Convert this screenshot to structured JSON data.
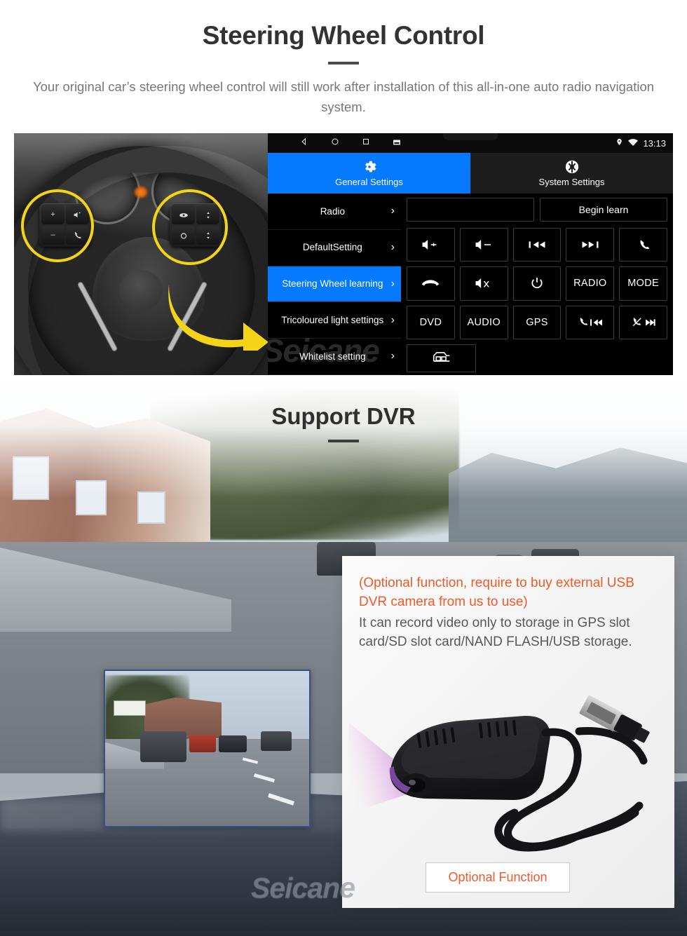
{
  "section1": {
    "title": "Steering Wheel Control",
    "subtitle": "Your original car’s steering wheel control will still work after installation of this all-in-one auto radio navigation system.",
    "accent_blue": "#0579ff",
    "highlight_yellow": "#f5d417"
  },
  "android": {
    "statusbar": {
      "back_icon": "back-triangle-icon",
      "home_icon": "home-circle-icon",
      "recents_icon": "recents-square-icon",
      "screenshot_icon": "screenshot-icon",
      "location_icon": "location-pin-icon",
      "wifi_icon": "wifi-icon",
      "time": "13:13"
    },
    "tabs": [
      {
        "label": "General Settings",
        "icon": "gear-icon",
        "active": true
      },
      {
        "label": "System Settings",
        "icon": "system-logo-icon",
        "active": false
      }
    ],
    "menu": [
      {
        "label": "Radio",
        "selected": false
      },
      {
        "label": "DefaultSetting",
        "selected": false
      },
      {
        "label": "Steering Wheel learning",
        "selected": true
      },
      {
        "label": "Tricoloured light settings",
        "selected": false
      },
      {
        "label": "Whitelist setting",
        "selected": false
      }
    ],
    "chevron": "›",
    "learn": {
      "input_value": "",
      "input_placeholder": "",
      "begin_button": "Begin learn"
    },
    "keys": [
      {
        "label": "",
        "icon": "volume-up-icon"
      },
      {
        "label": "",
        "icon": "volume-down-icon"
      },
      {
        "label": "",
        "icon": "previous-track-icon"
      },
      {
        "label": "",
        "icon": "next-track-icon"
      },
      {
        "label": "",
        "icon": "phone-answer-icon"
      },
      {
        "label": "",
        "icon": "phone-hangup-icon"
      },
      {
        "label": "",
        "icon": "mute-icon"
      },
      {
        "label": "",
        "icon": "power-icon"
      },
      {
        "label": "RADIO",
        "icon": ""
      },
      {
        "label": "MODE",
        "icon": ""
      },
      {
        "label": "DVD",
        "icon": ""
      },
      {
        "label": "AUDIO",
        "icon": ""
      },
      {
        "label": "GPS",
        "icon": ""
      },
      {
        "label": "",
        "icon": "phone-previous-icon"
      },
      {
        "label": "",
        "icon": "phone-end-next-icon"
      }
    ],
    "car_button_icon": "car-icon",
    "watermark": "Seicane"
  },
  "section2": {
    "title": "Support DVR",
    "info_red": "(Optional function, require to buy external USB DVR camera from us to use)",
    "info_grey": "It can record video only to storage in GPS slot card/SD slot card/NAND FLASH/USB storage.",
    "optional_button": "Optional Function",
    "watermark": "Seicane",
    "accent_orange": "#f0572a"
  }
}
